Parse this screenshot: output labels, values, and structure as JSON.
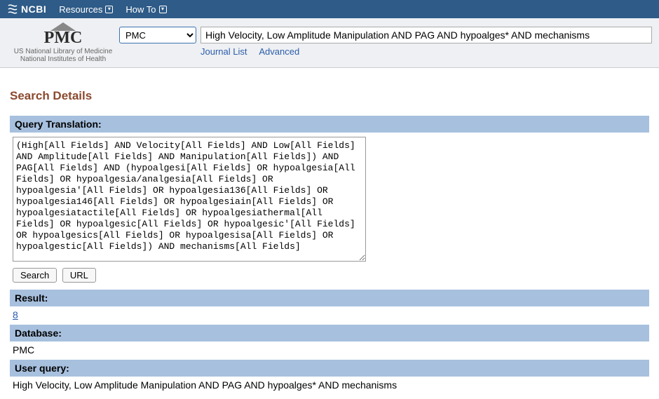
{
  "topnav": {
    "brand": "NCBI",
    "items": [
      "Resources",
      "How To"
    ]
  },
  "header": {
    "logo_label": "PMC",
    "sub1": "US National Library of Medicine",
    "sub2": "National Institutes of Health",
    "db_selected": "PMC",
    "search_value": "High Velocity, Low Amplitude Manipulation AND PAG AND hypoalges* AND mechanisms",
    "links": {
      "journal_list": "Journal List",
      "advanced": "Advanced"
    }
  },
  "page": {
    "title": "Search Details",
    "sections": {
      "query_translation_label": "Query Translation:",
      "query_translation_value": "(High[All Fields] AND Velocity[All Fields] AND Low[All Fields] AND Amplitude[All Fields] AND Manipulation[All Fields]) AND PAG[All Fields] AND (hypoalgesi[All Fields] OR hypoalgesia[All Fields] OR hypoalgesia/analgesia[All Fields] OR hypoalgesia'[All Fields] OR hypoalgesia136[All Fields] OR hypoalgesia146[All Fields] OR hypoalgesiain[All Fields] OR hypoalgesiatactile[All Fields] OR hypoalgesiathermal[All Fields] OR hypoalgesic[All Fields] OR hypoalgesic'[All Fields] OR hypoalgesics[All Fields] OR hypoalgesisa[All Fields] OR hypoalgestic[All Fields]) AND mechanisms[All Fields]",
      "search_btn": "Search",
      "url_btn": "URL",
      "result_label": "Result:",
      "result_value": "8",
      "database_label": "Database:",
      "database_value": "PMC",
      "user_query_label": "User query:",
      "user_query_value": "High Velocity, Low Amplitude Manipulation AND PAG AND hypoalges* AND mechanisms"
    }
  }
}
